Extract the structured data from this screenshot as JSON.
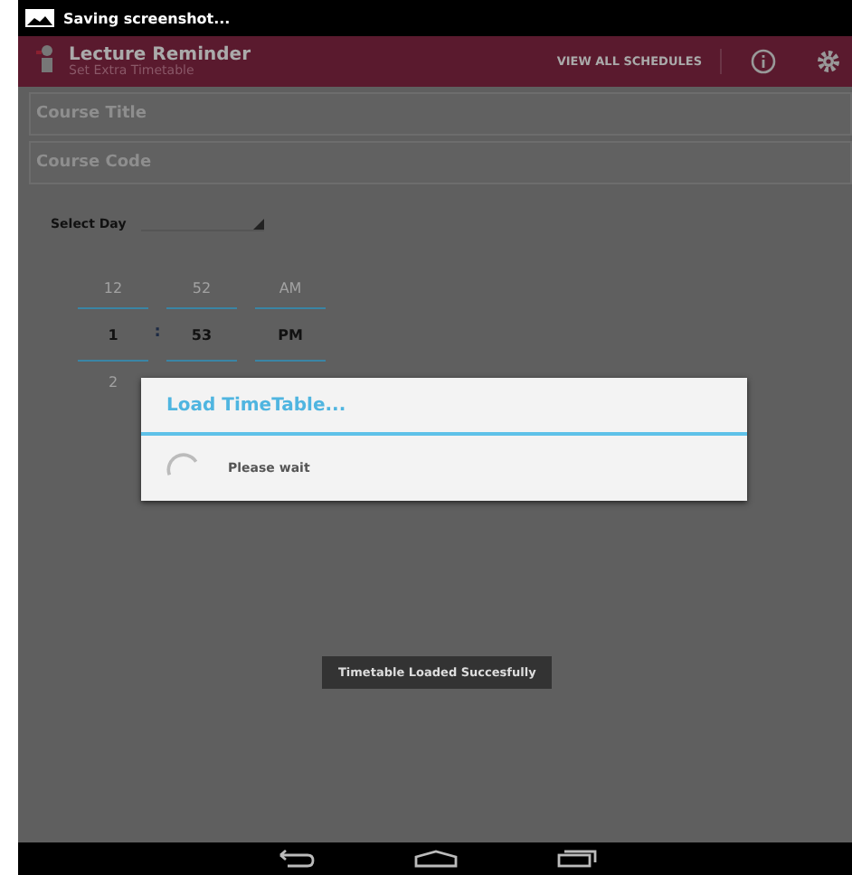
{
  "status_bar": {
    "notification": "Saving screenshot..."
  },
  "app_bar": {
    "title": "Lecture Reminder",
    "subtitle": "Set Extra Timetable",
    "action": "VIEW ALL SCHEDULES"
  },
  "form": {
    "fields": [
      {
        "placeholder": "Course Title"
      },
      {
        "placeholder": "Course Code"
      }
    ],
    "day_label": "Select Day",
    "time_picker": {
      "columns": [
        {
          "prev": "12",
          "current": "1",
          "next": "2"
        },
        {
          "prev": "52",
          "current": "53"
        },
        {
          "prev": "AM",
          "current": "PM"
        }
      ],
      "separator": ":"
    }
  },
  "dialog": {
    "title": "Load TimeTable...",
    "message": "Please wait"
  },
  "toast": "Timetable Loaded Succesfully"
}
